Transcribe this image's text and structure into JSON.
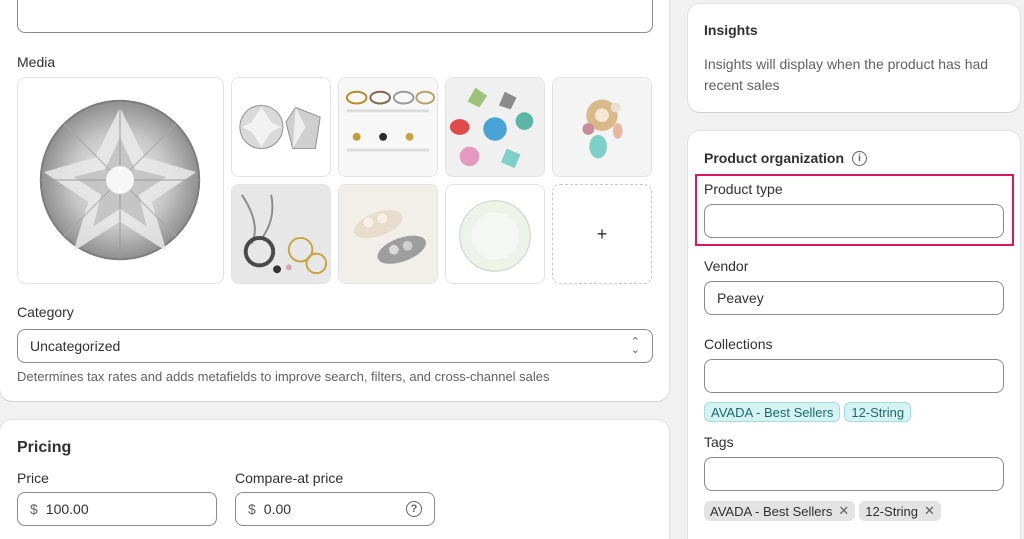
{
  "media": {
    "label": "Media",
    "add_symbol": "+"
  },
  "category": {
    "label": "Category",
    "value": "Uncategorized",
    "help": "Determines tax rates and adds metafields to improve search, filters, and cross-channel sales"
  },
  "pricing": {
    "title": "Pricing",
    "price_label": "Price",
    "price_currency": "$",
    "price_value": "100.00",
    "compare_label": "Compare-at price",
    "compare_currency": "$",
    "compare_value": "0.00"
  },
  "insights": {
    "title": "Insights",
    "text": "Insights will display when the product has had recent sales"
  },
  "organization": {
    "title": "Product organization",
    "product_type_label": "Product type",
    "product_type_value": "",
    "vendor_label": "Vendor",
    "vendor_value": "Peavey",
    "collections_label": "Collections",
    "collections_value": "",
    "collection_chips": [
      "AVADA - Best Sellers",
      "12-String"
    ],
    "tags_label": "Tags",
    "tags_value": "",
    "tag_chips": [
      "AVADA - Best Sellers",
      "12-String"
    ]
  },
  "colors": {
    "highlight": "#d8175f",
    "chip_teal_bg": "#d5f3f3",
    "chip_grey_bg": "#e3e3e3"
  }
}
